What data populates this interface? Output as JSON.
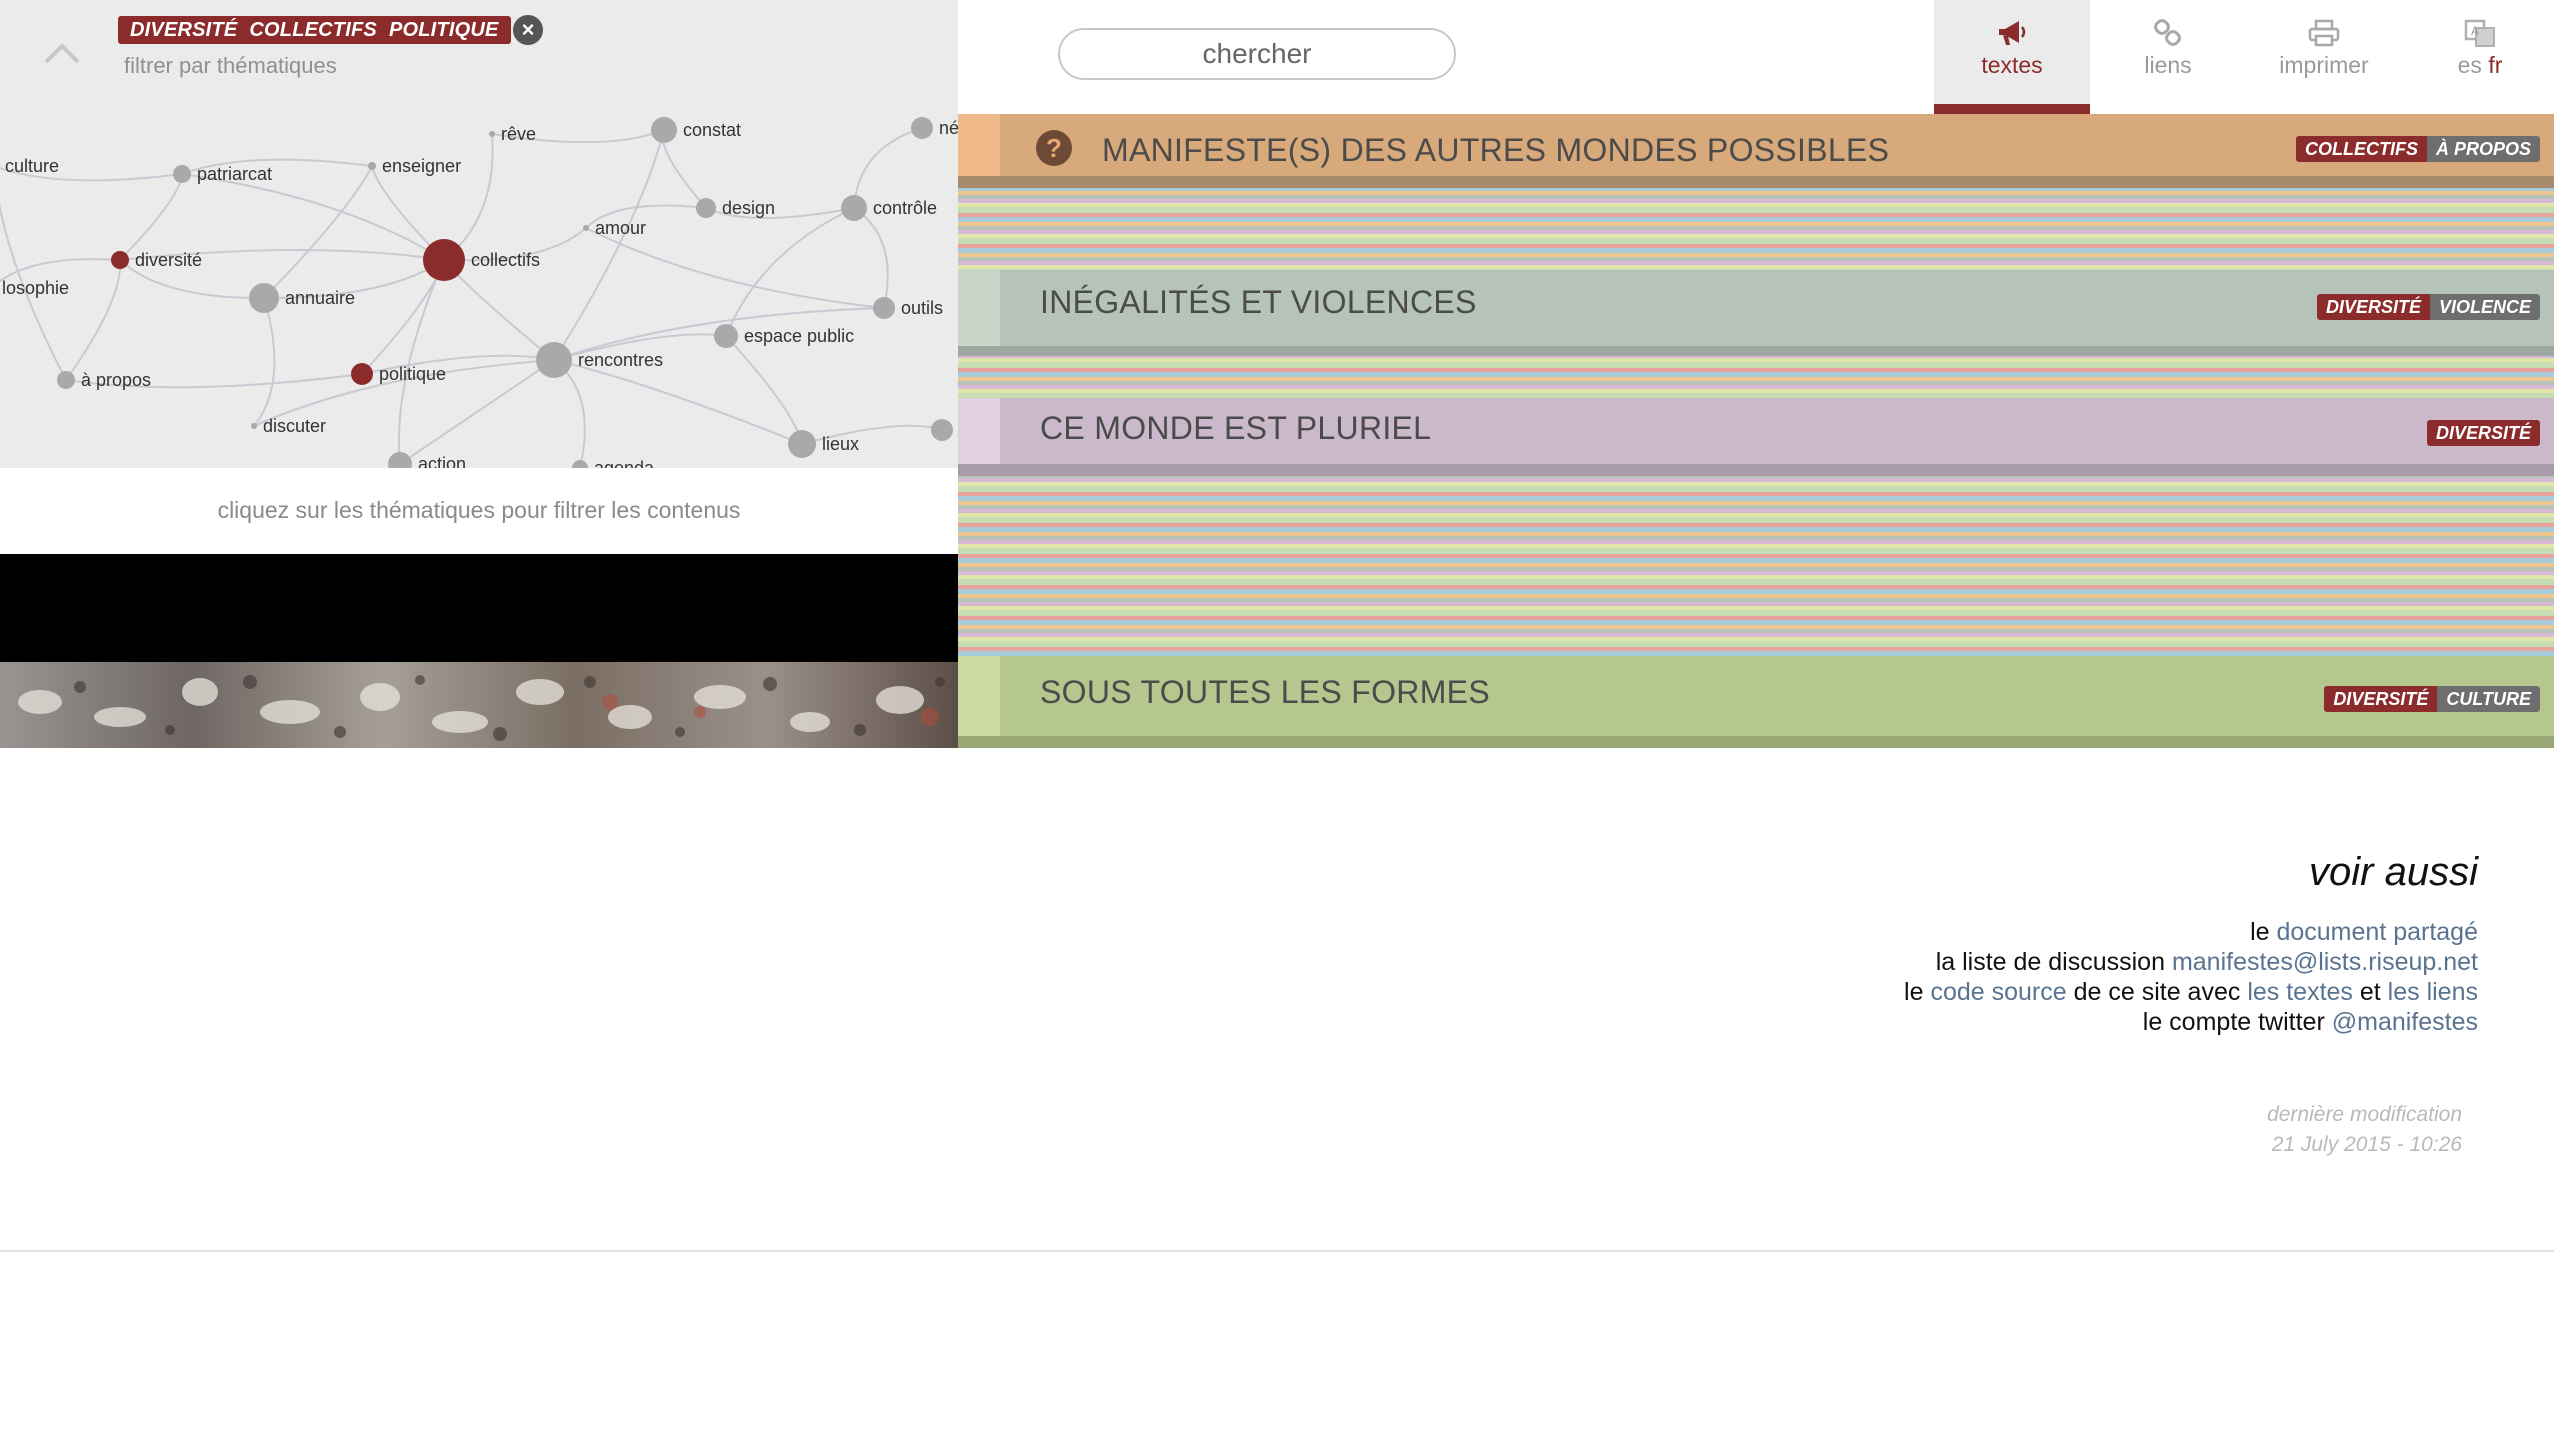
{
  "filter": {
    "active_tags": [
      "diversité",
      "collectifs",
      "politique"
    ],
    "hint": "filtrer par thématiques",
    "clear_icon": "close-icon",
    "collapse_icon": "chevron-up-icon"
  },
  "graph": {
    "caption": "cliquez sur les thématiques pour filtrer les contenus",
    "nodes": [
      {
        "id": "culture",
        "label": "culture",
        "active": false
      },
      {
        "id": "patriarcat",
        "label": "patriarcat",
        "active": false
      },
      {
        "id": "enseigner",
        "label": "enseigner",
        "active": false
      },
      {
        "id": "reve",
        "label": "rêve",
        "active": false
      },
      {
        "id": "constat",
        "label": "constat",
        "active": false
      },
      {
        "id": "ne",
        "label": "né",
        "active": false
      },
      {
        "id": "design",
        "label": "design",
        "active": false
      },
      {
        "id": "controle",
        "label": "contrôle",
        "active": false
      },
      {
        "id": "amour",
        "label": "amour",
        "active": false
      },
      {
        "id": "diversite",
        "label": "diversité",
        "active": true
      },
      {
        "id": "philosophie",
        "label": "losophie",
        "active": false
      },
      {
        "id": "annuaire",
        "label": "annuaire",
        "active": false
      },
      {
        "id": "collectifs",
        "label": "collectifs",
        "active": true
      },
      {
        "id": "outils",
        "label": "outils",
        "active": false
      },
      {
        "id": "espace",
        "label": "espace public",
        "active": false
      },
      {
        "id": "apropos",
        "label": "à propos",
        "active": false
      },
      {
        "id": "politique",
        "label": "politique",
        "active": true
      },
      {
        "id": "rencontres",
        "label": "rencontres",
        "active": false
      },
      {
        "id": "discuter",
        "label": "discuter",
        "active": false
      },
      {
        "id": "lieux",
        "label": "lieux",
        "active": false
      },
      {
        "id": "action",
        "label": "action",
        "active": false
      },
      {
        "id": "agenda",
        "label": "agenda",
        "active": false
      },
      {
        "id": "edge_r",
        "label": "",
        "active": false
      }
    ]
  },
  "search": {
    "placeholder": "chercher"
  },
  "nav": {
    "tabs": [
      {
        "id": "textes",
        "label": "textes",
        "icon": "megaphone-icon",
        "active": true
      },
      {
        "id": "liens",
        "label": "liens",
        "icon": "link-icon",
        "active": false
      },
      {
        "id": "imprimer",
        "label": "imprimer",
        "icon": "printer-icon",
        "active": false
      }
    ],
    "lang": {
      "icon": "translate-icon",
      "other": "es",
      "active": "fr"
    }
  },
  "texts": [
    {
      "title": "MANIFESTE(S) DES AUTRES MONDES POSSIBLES",
      "icon": "question-icon",
      "tags": [
        "collectifs",
        "à propos"
      ]
    },
    {
      "title": "INÉGALITÉS ET VIOLENCES",
      "tags": [
        "diversité",
        "violence"
      ]
    },
    {
      "title": "CE MONDE EST PLURIEL",
      "tags": [
        "diversité"
      ]
    },
    {
      "title": "SOUS TOUTES LES FORMES",
      "tags": [
        "diversité",
        "culture"
      ]
    }
  ],
  "see_also": {
    "title": "voir aussi",
    "line1": {
      "pre": "le ",
      "link": "document partagé"
    },
    "line2": {
      "pre": "la liste de discussion ",
      "link": "manifestes@lists.riseup.net"
    },
    "line3": {
      "pre": "le ",
      "link1": "code source",
      "mid": " de ce site avec ",
      "link2": "les textes",
      "and": " et ",
      "link3": "les liens"
    },
    "line4": {
      "pre": "le compte twitter ",
      "link": "@manifestes"
    }
  },
  "last_modified": {
    "label": "dernière modification",
    "date": "21 July 2015 - 10:26"
  },
  "colors": {
    "accent": "#8c2b2b",
    "link": "#5a7391"
  }
}
